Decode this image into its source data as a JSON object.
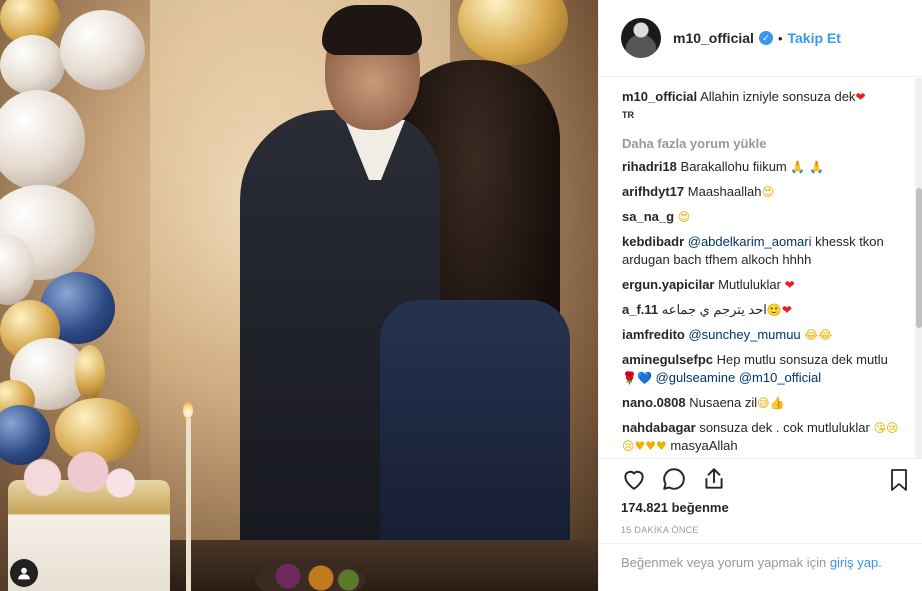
{
  "post": {
    "username": "m10_official",
    "follow_label": "Takip Et",
    "dot": "•",
    "caption": {
      "user": "m10_official",
      "text": "Allahin izniyle sonsuza dek",
      "emoji": "❤",
      "language": "TR"
    },
    "load_more": "Daha fazla yorum yükle",
    "comments": [
      {
        "user": "rihadri18",
        "text": "Barakallohu fiikum",
        "emoji": "🙏 🙏"
      },
      {
        "user": "arifhdyt17",
        "text": "Maashaallah",
        "emoji": "😍"
      },
      {
        "user": "sa_na_g",
        "text": "",
        "emoji": "😍"
      },
      {
        "user": "kebdibadr",
        "mention": "@abdelkarim_aomari",
        "text": "khessk tkon ardugan bach tfhem alkoch hhhh"
      },
      {
        "user": "ergun.yapicilar",
        "text": "Mutluluklar",
        "emoji": "❤"
      },
      {
        "user": "a_f.11",
        "text": "احد يترجم ي جماعه",
        "emoji": "🙂❤"
      },
      {
        "user": "iamfredito",
        "mention": "@sunchey_mumuu",
        "emoji": "😂😂"
      },
      {
        "user": "aminegulsefpc",
        "text": "Hep mutlu sonsuza dek mutlu",
        "emoji": "🌹💙",
        "mention": "@gulseamine",
        "mention2": "@m10_official"
      },
      {
        "user": "nano.0808",
        "text": "Nusaena zil",
        "emoji": "😅👍"
      },
      {
        "user": "nahdabagar",
        "text": "sonsuza dek . cok mutluluklar",
        "emoji": "😘😢😢♥♥♥",
        "text2": "masyaAllah"
      }
    ],
    "likes": "174.821 beğenme",
    "time": "15 DAKİKA ÖNCE",
    "login_prompt": "Beğenmek veya yorum yapmak için",
    "login_link": "giriş yap."
  },
  "icons": {
    "like": "heart-outline-icon",
    "comment": "comment-icon",
    "share": "share-icon",
    "save": "bookmark-icon",
    "verified": "verified-badge-icon",
    "user_tag": "user-tag-icon"
  },
  "colors": {
    "accent": "#3897f0",
    "heart": "#ed1c24",
    "muted": "#999999",
    "text": "#262626"
  }
}
